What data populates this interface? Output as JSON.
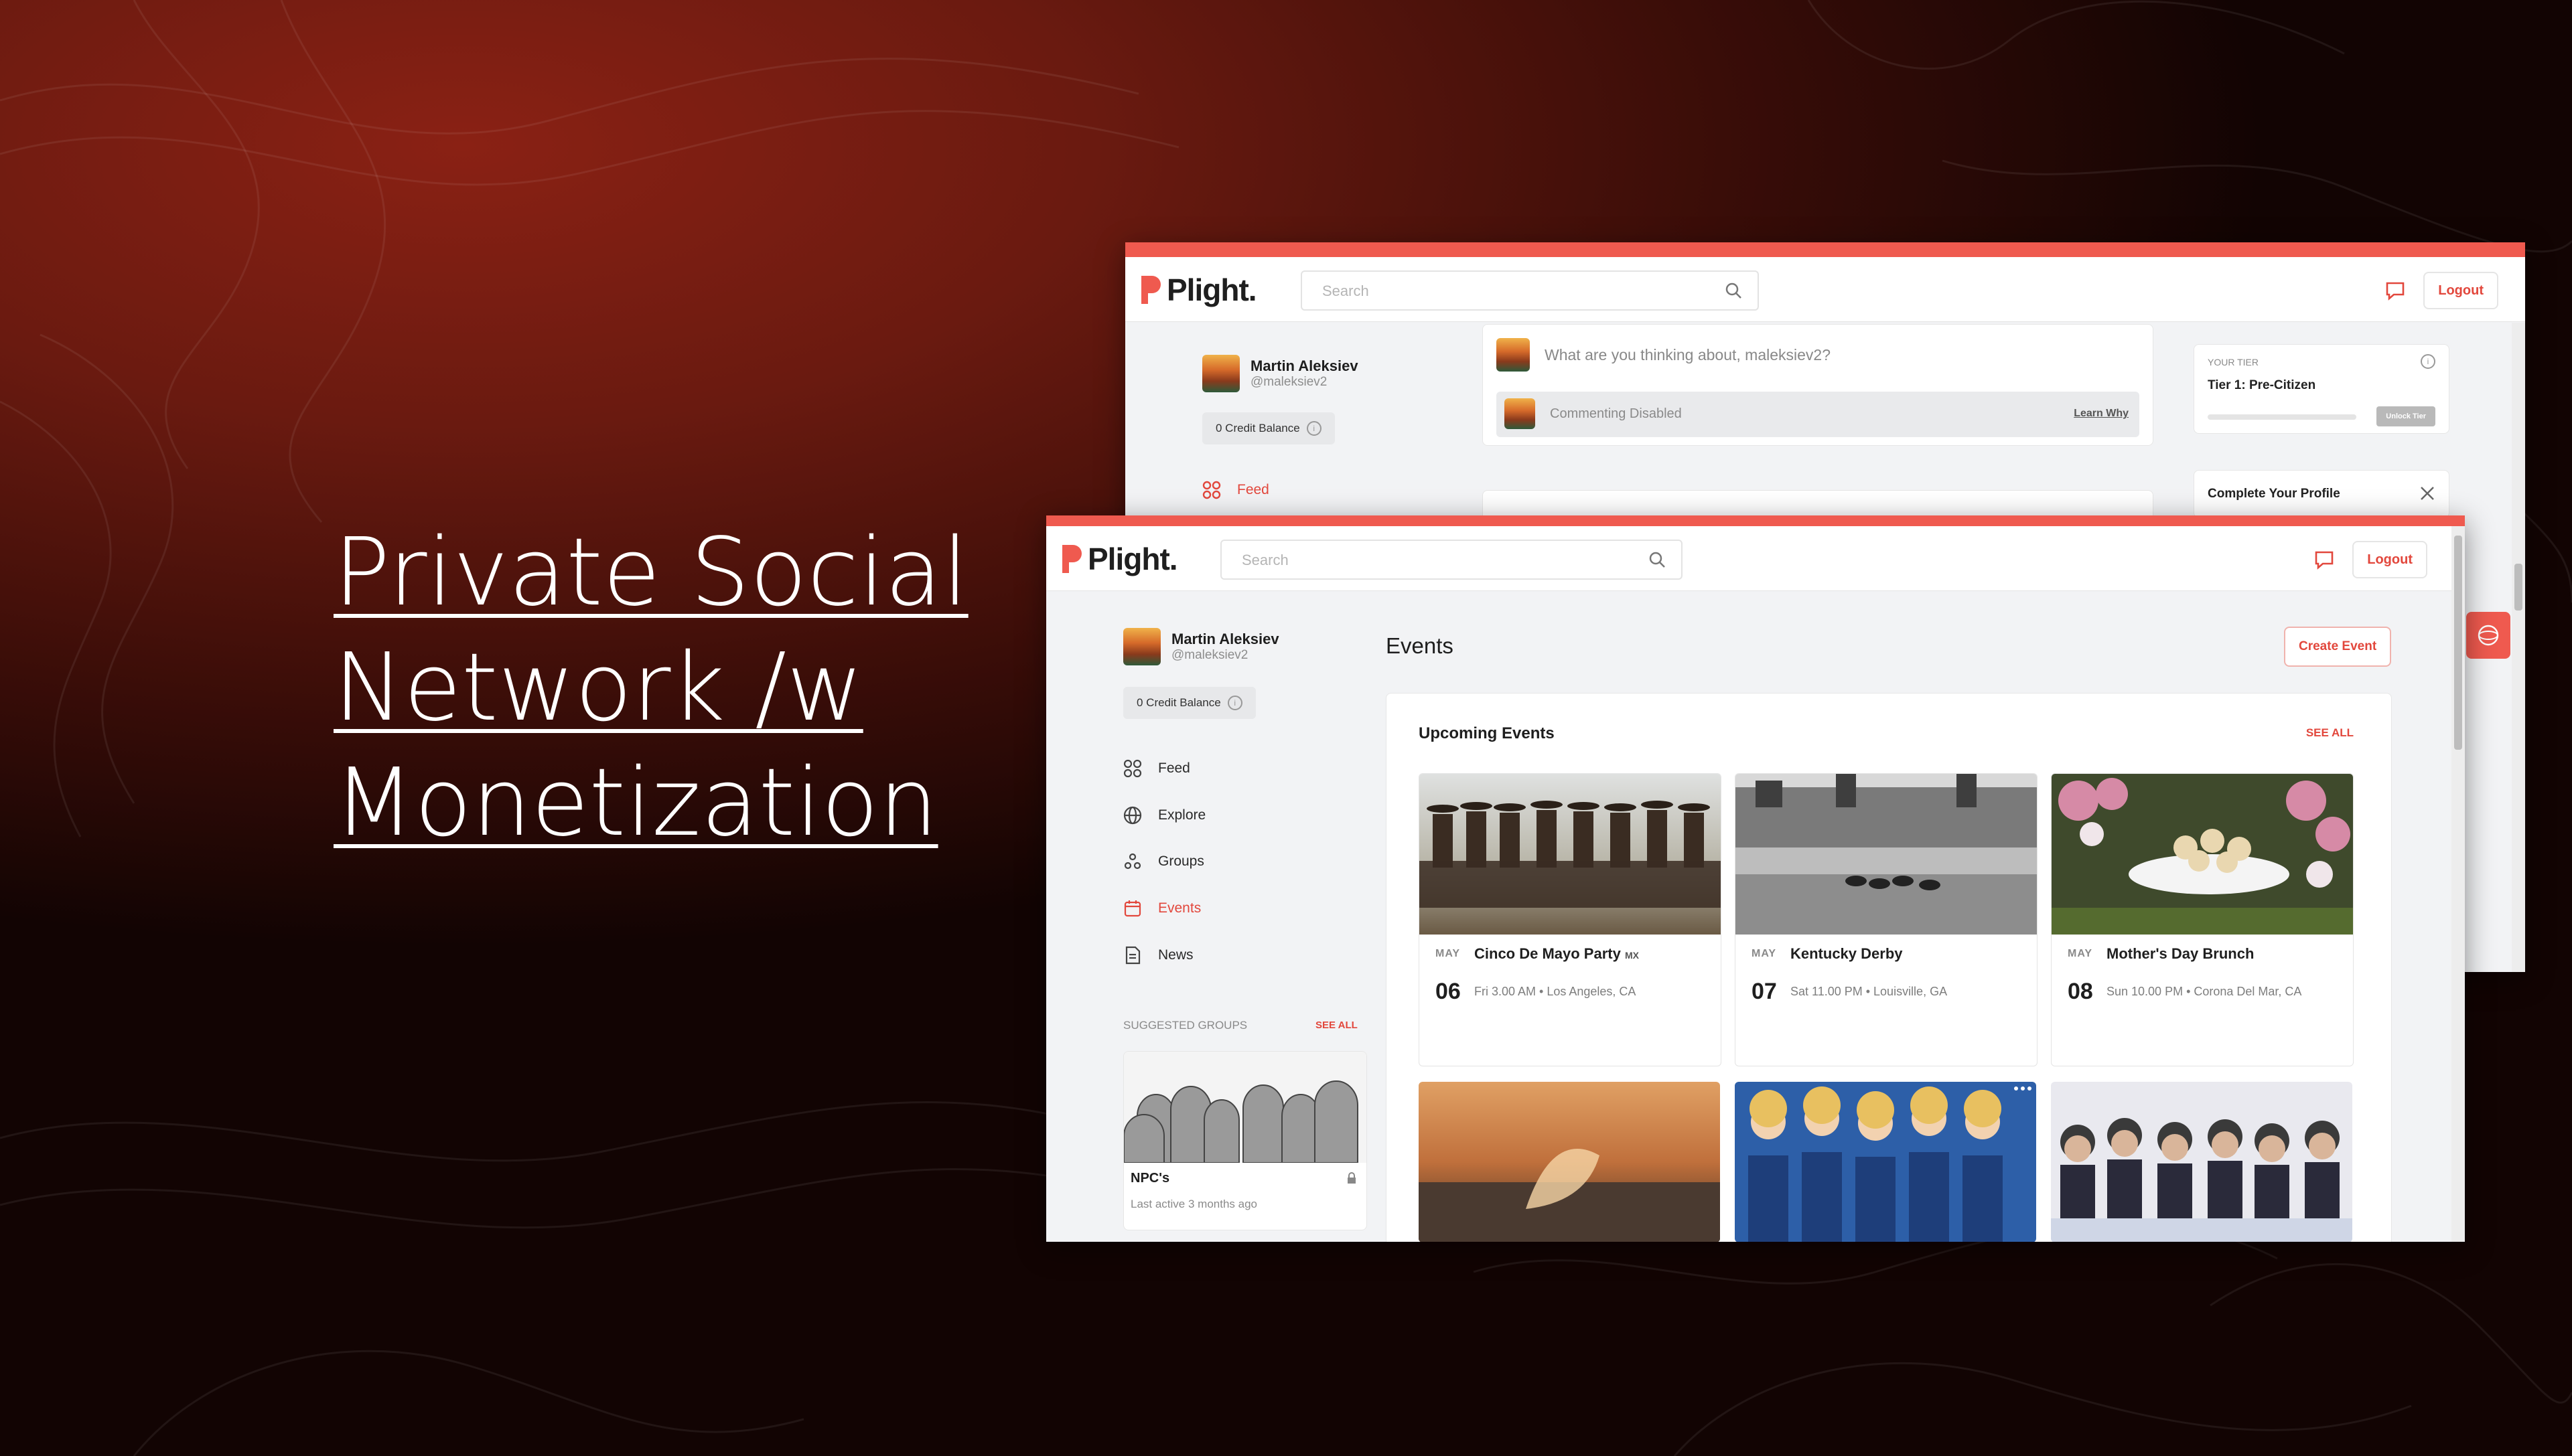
{
  "headline": {
    "line1": "Private Social",
    "line2": "Network /w",
    "line3": "Monetization"
  },
  "app": {
    "brand": "Plight.",
    "search_placeholder": "Search",
    "logout_label": "Logout",
    "accent_color": "#e2473c"
  },
  "user": {
    "name": "Martin Aleksiev",
    "handle": "@maleksiev2",
    "credit_balance": "0 Credit Balance"
  },
  "back_screen": {
    "composer_placeholder": "What are you thinking about, maleksiev2?",
    "commenting_disabled": "Commenting Disabled",
    "learn_why": "Learn Why",
    "tier_label": "YOUR TIER",
    "tier_name": "Tier 1: Pre-Citizen",
    "unlock_tier": "Unlock Tier",
    "complete_profile": "Complete Your Profile",
    "nav_feed": "Feed"
  },
  "front_screen": {
    "nav": [
      {
        "label": "Feed",
        "icon": "grid-icon"
      },
      {
        "label": "Explore",
        "icon": "globe-icon"
      },
      {
        "label": "Groups",
        "icon": "groups-icon"
      },
      {
        "label": "Events",
        "icon": "calendar-icon"
      },
      {
        "label": "News",
        "icon": "document-icon"
      }
    ],
    "suggested_groups_label": "SUGGESTED GROUPS",
    "see_all": "SEE ALL",
    "group": {
      "name": "NPC's",
      "last_active": "Last active 3 months ago"
    },
    "page_title": "Events",
    "create_event": "Create Event",
    "upcoming_title": "Upcoming Events",
    "upcoming_see_all": "SEE ALL",
    "events": [
      {
        "month": "MAY",
        "day": "06",
        "title": "Cinco De Mayo Party",
        "suffix": "MX",
        "meta": "Fri 3.00 AM • Los Angeles, CA"
      },
      {
        "month": "MAY",
        "day": "07",
        "title": "Kentucky Derby",
        "suffix": "",
        "meta": "Sat 11.00 PM • Louisville, GA"
      },
      {
        "month": "MAY",
        "day": "08",
        "title": "Mother's Day Brunch",
        "suffix": "",
        "meta": "Sun 10.00 PM • Corona Del Mar, CA"
      }
    ]
  }
}
